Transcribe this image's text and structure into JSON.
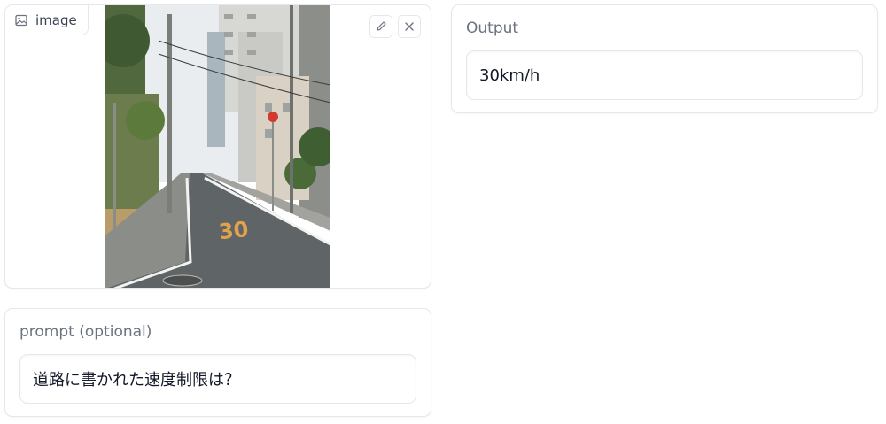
{
  "image_panel": {
    "label": "image",
    "label_icon": "image-icon",
    "edit_icon": "pencil-icon",
    "clear_icon": "close-icon",
    "road_marking": "30"
  },
  "output_panel": {
    "label": "Output",
    "value": "30km/h"
  },
  "prompt_panel": {
    "label": "prompt (optional)",
    "value": "道路に書かれた速度制限は？"
  },
  "colors": {
    "border": "#e5e7eb",
    "label_text": "#6b7280",
    "road_marking": "#e0a24c"
  }
}
